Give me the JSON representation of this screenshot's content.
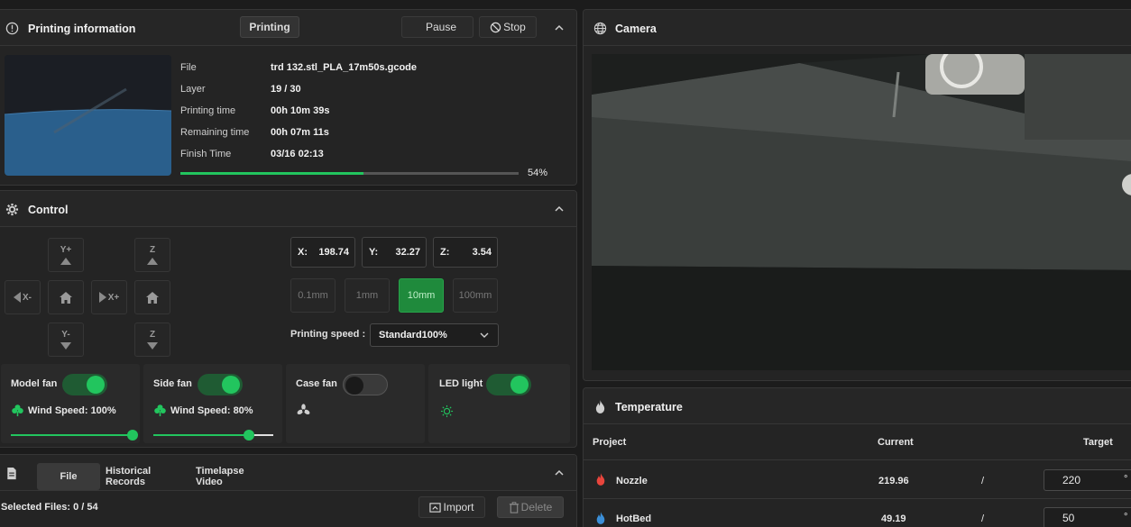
{
  "printing": {
    "title": "Printing information",
    "status": "Printing",
    "pause_label": "Pause",
    "stop_label": "Stop",
    "rows": [
      {
        "label": "File",
        "value": "trd 132.stl_PLA_17m50s.gcode"
      },
      {
        "label": "Layer",
        "value": "19 / 30"
      },
      {
        "label": "Printing time",
        "value": "00h 10m 39s"
      },
      {
        "label": "Remaining time",
        "value": "00h 07m 11s"
      },
      {
        "label": "Finish Time",
        "value": "03/16 02:13"
      }
    ],
    "progress_percent": 54,
    "progress_label": "54%"
  },
  "control": {
    "title": "Control",
    "jog": {
      "y_plus": "Y+",
      "y_minus": "Y-",
      "x_minus": "X-",
      "x_plus": "X+",
      "z_up": "Z",
      "z_down": "Z"
    },
    "coords": {
      "x_label": "X:",
      "x": "198.74",
      "y_label": "Y:",
      "y": "32.27",
      "z_label": "Z:",
      "z": "3.54"
    },
    "steps": [
      "0.1mm",
      "1mm",
      "10mm",
      "100mm"
    ],
    "active_step": "10mm",
    "speed_label": "Printing speed :",
    "speed_value": "Standard100%",
    "fans": [
      {
        "name": "Model fan",
        "on": true,
        "speed_text": "Wind Speed: 100%",
        "speed": 100
      },
      {
        "name": "Side fan",
        "on": true,
        "speed_text": "Wind Speed: 80%",
        "speed": 80
      },
      {
        "name": "Case fan",
        "on": false
      },
      {
        "name": "LED light",
        "on": true
      }
    ]
  },
  "files": {
    "tabs": [
      "File",
      "Historical Records",
      "Timelapse Video"
    ],
    "selected_text": "Selected Files: 0 / 54",
    "import_label": "Import",
    "delete_label": "Delete"
  },
  "camera": {
    "title": "Camera"
  },
  "temperature": {
    "title": "Temperature",
    "headers": {
      "project": "Project",
      "current": "Current",
      "target": "Target"
    },
    "rows": [
      {
        "name": "Nozzle",
        "current": "219.96",
        "sep": "/",
        "target": "220",
        "unit": "°"
      },
      {
        "name": "HotBed",
        "current": "49.19",
        "sep": "/",
        "target": "50",
        "unit": "°"
      }
    ]
  },
  "colors": {
    "accent": "#22c55e",
    "nozzle": "#e8453c",
    "hotbed": "#3b8fd8"
  }
}
